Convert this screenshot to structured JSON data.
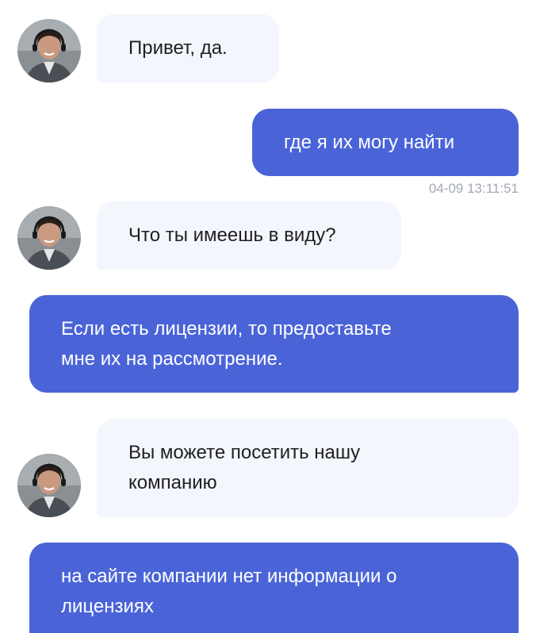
{
  "chat": {
    "messages": [
      {
        "direction": "incoming",
        "text": "Привет, да."
      },
      {
        "direction": "outgoing",
        "text": "где я их могу найти",
        "timestamp": "04-09 13:11:51"
      },
      {
        "direction": "incoming",
        "text": "Что ты имеешь в виду?"
      },
      {
        "direction": "outgoing",
        "text_lines": [
          "Если есть лицензии, то предоставьте",
          "мне их на рассмотрение."
        ]
      },
      {
        "direction": "incoming",
        "text_lines": [
          "Вы можете посетить нашу",
          "компанию"
        ]
      },
      {
        "direction": "outgoing",
        "text_lines": [
          "на сайте компании нет информации о",
          "лицензиях"
        ]
      }
    ]
  },
  "colors": {
    "outgoing_bubble": "#4a64d8",
    "incoming_bubble": "#f3f6fd",
    "timestamp_text": "#a3a8b3"
  },
  "icons": {
    "agent_avatar": "agent-avatar-icon"
  }
}
